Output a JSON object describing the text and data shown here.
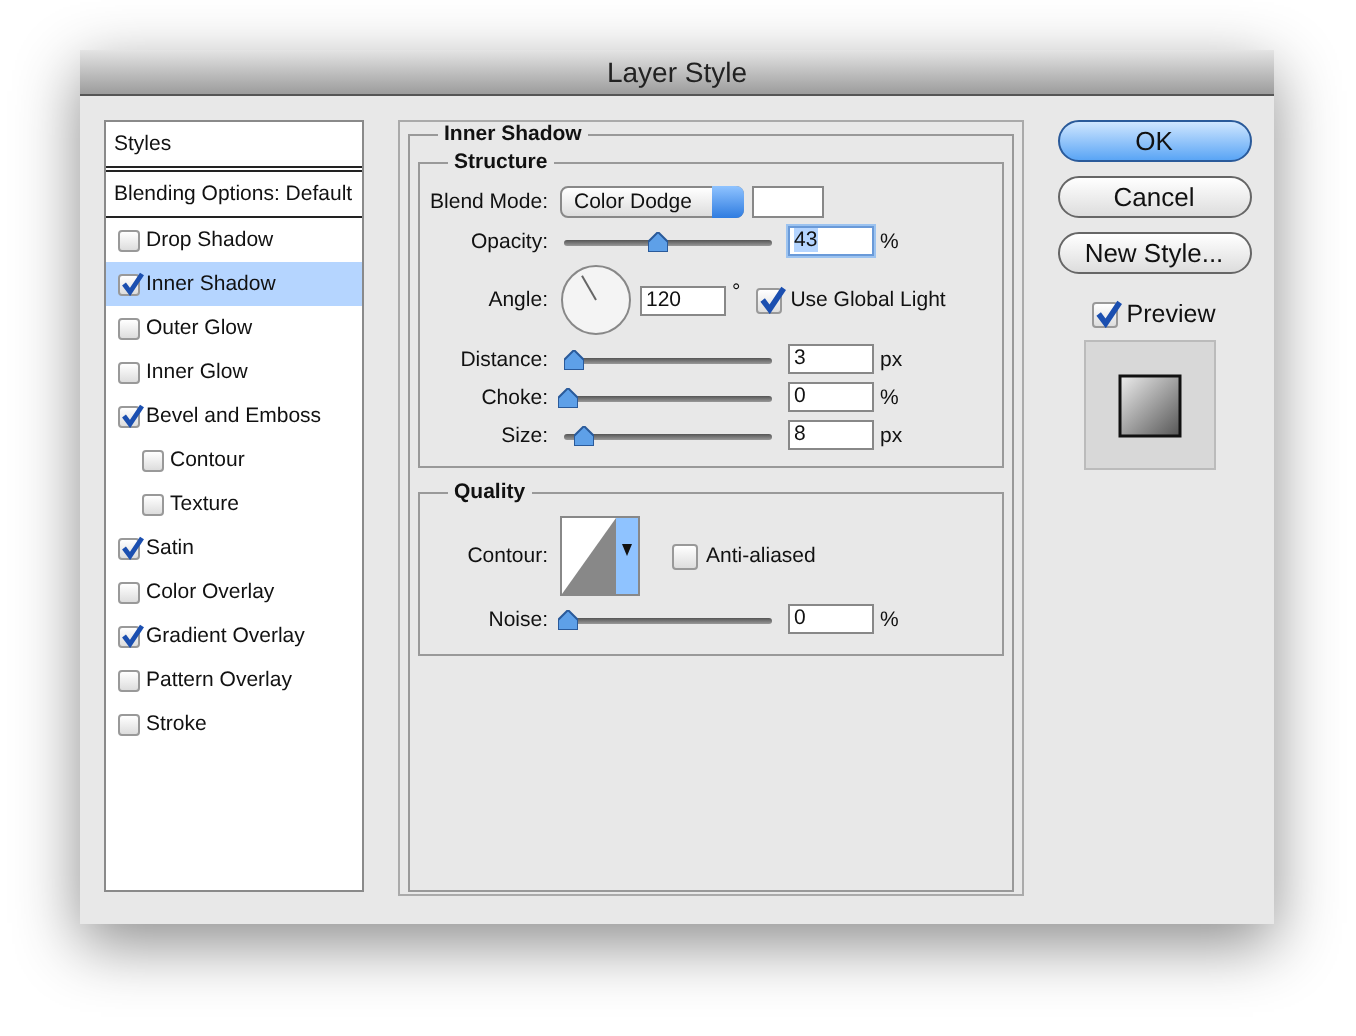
{
  "window": {
    "title": "Layer Style"
  },
  "styles_list": {
    "header": "Styles",
    "blending_options": "Blending Options: Default",
    "items": [
      {
        "label": "Drop Shadow",
        "checked": false,
        "selected": false
      },
      {
        "label": "Inner Shadow",
        "checked": true,
        "selected": true
      },
      {
        "label": "Outer Glow",
        "checked": false,
        "selected": false
      },
      {
        "label": "Inner Glow",
        "checked": false,
        "selected": false
      },
      {
        "label": "Bevel and Emboss",
        "checked": true,
        "selected": false,
        "children": [
          {
            "label": "Contour",
            "checked": false,
            "selected": false
          },
          {
            "label": "Texture",
            "checked": false,
            "selected": false
          }
        ]
      },
      {
        "label": "Satin",
        "checked": true,
        "selected": false
      },
      {
        "label": "Color Overlay",
        "checked": false,
        "selected": false
      },
      {
        "label": "Gradient Overlay",
        "checked": true,
        "selected": false
      },
      {
        "label": "Pattern Overlay",
        "checked": false,
        "selected": false
      },
      {
        "label": "Stroke",
        "checked": false,
        "selected": false
      }
    ]
  },
  "inner_shadow": {
    "title": "Inner Shadow",
    "structure": {
      "title": "Structure",
      "rows": [
        {
          "kind": "select",
          "label": "Blend Mode:",
          "value": "Color Dodge"
        },
        {
          "kind": "slider",
          "label": "Opacity:",
          "level": 0.43,
          "value": "43",
          "unit": "%",
          "highlighted": true
        },
        {
          "kind": "angle",
          "label": "Angle:",
          "value": "120",
          "unit": "°",
          "checkbox": {
            "label": "Use Global Light",
            "checked": true
          }
        },
        {
          "kind": "slider",
          "label": "Distance:",
          "level": 0.03,
          "value": "3",
          "unit": "px",
          "highlighted": false
        },
        {
          "kind": "slider",
          "label": "Choke:",
          "level": 0,
          "value": "0",
          "unit": "%",
          "highlighted": false
        },
        {
          "kind": "slider",
          "label": "Size:",
          "level": 0.08,
          "value": "8",
          "unit": "px",
          "highlighted": false
        }
      ]
    },
    "quality": {
      "title": "Quality",
      "rows": [
        {
          "kind": "contour",
          "label": "Contour:",
          "checkbox": {
            "label": "Anti-aliased",
            "checked": false
          }
        },
        {
          "kind": "slider",
          "label": "Noise:",
          "level": 0,
          "value": "0",
          "unit": "%",
          "highlighted": false
        }
      ]
    }
  },
  "buttons": [
    {
      "label": "OK",
      "default": true
    },
    {
      "label": "Cancel",
      "default": false
    },
    {
      "label": "New Style...",
      "default": false
    }
  ],
  "preview": {
    "label": "Preview",
    "checked": true
  }
}
